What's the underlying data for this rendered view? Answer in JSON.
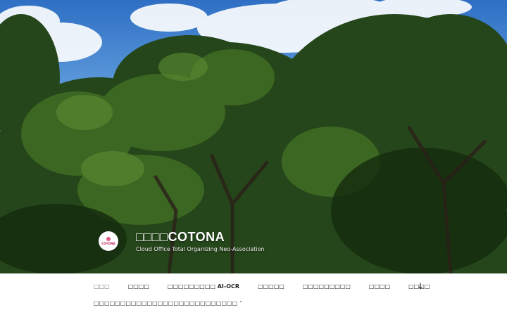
{
  "site": {
    "title": "□□□□COTONA",
    "description": "Cloud Office Total Organizing Neo-Association",
    "logo_text": "COTONA"
  },
  "nav": {
    "items": [
      {
        "label": "□□□",
        "current": true
      },
      {
        "label": "□□□□"
      },
      {
        "label": "□□□□□□□□□ AI-OCR"
      },
      {
        "label": "□□□□□"
      },
      {
        "label": "□□□□□□□□□"
      },
      {
        "label": "□□□□"
      },
      {
        "label": "□□□□"
      }
    ],
    "submenu_label": "□□□□□□□□□□□□□□□□□□□□□□□□□□□",
    "submenu_chevron": "˅",
    "scroll_icon": "↓"
  },
  "colors": {
    "sky": "#5a97d9",
    "foliage_dark": "#1e3a14",
    "nav_text": "#222222",
    "nav_current": "#767676"
  }
}
